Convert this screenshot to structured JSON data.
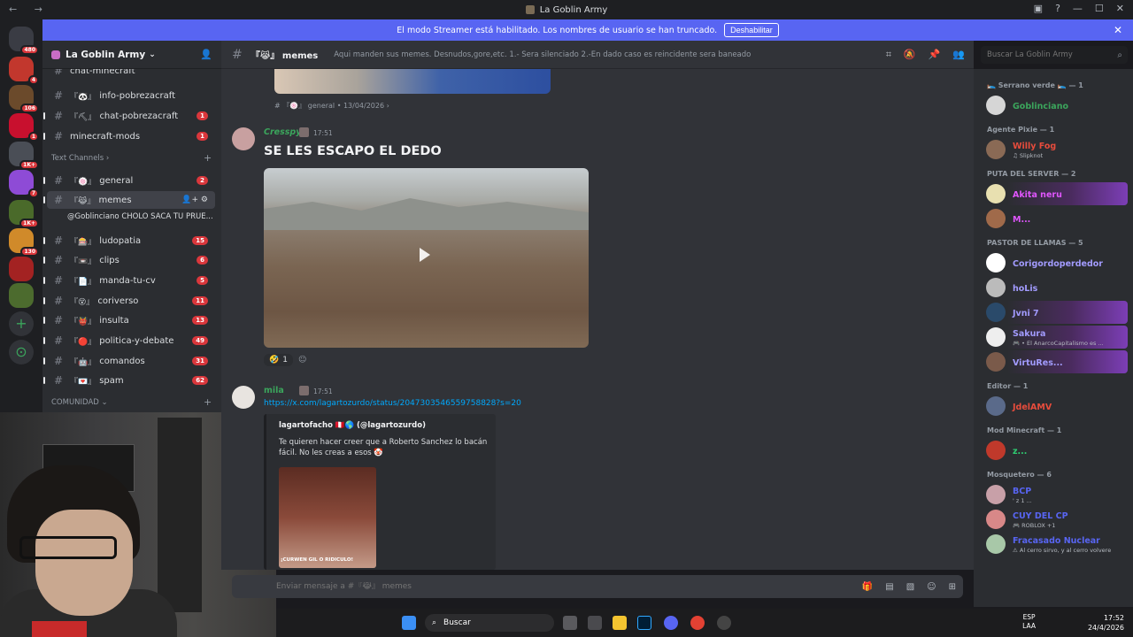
{
  "window": {
    "title": "La Goblin Army"
  },
  "banner": {
    "text": "El modo Streamer está habilitado. Los nombres de usuario se han truncado.",
    "button": "Deshabilitar"
  },
  "guilds": [
    {
      "badge": "480",
      "color": "#3a3c44"
    },
    {
      "badge": "4",
      "color": "#c2372d"
    },
    {
      "badge": "106",
      "color": "#6b4a2b"
    },
    {
      "badge": "1",
      "color": "#c8102e"
    },
    {
      "badge": "1K+",
      "color": "#4a4e56"
    },
    {
      "badge": "7",
      "color": "#8e4bd6"
    },
    {
      "badge": "1K+",
      "color": "#4a6a2a"
    },
    {
      "badge": "130",
      "color": "#d08a2a"
    },
    {
      "badge": "",
      "color": "#a32222"
    },
    {
      "badge": "",
      "color": "#4c6b2e"
    }
  ],
  "server": {
    "name": "La Goblin Army"
  },
  "channels": {
    "top_partial": {
      "name": "chat-minecraft",
      "badge": ""
    },
    "items_top": [
      {
        "emoji": "『🐼』",
        "name": "info-pobrezacraft",
        "badge": ""
      },
      {
        "emoji": "『⛏』",
        "name": "chat-pobrezacraft",
        "badge": "1"
      },
      {
        "emoji": "",
        "name": "minecraft-mods",
        "badge": "1"
      }
    ],
    "category_text": "Text Channels",
    "items": [
      {
        "emoji": "『🍥』",
        "name": "general",
        "badge": "2"
      },
      {
        "emoji": "『😹』",
        "name": "memes",
        "badge": ""
      },
      {
        "emoji": "『🎰』",
        "name": "ludopatia",
        "badge": "15"
      },
      {
        "emoji": "『📼』",
        "name": "clips",
        "badge": "6"
      },
      {
        "emoji": "『📄』",
        "name": "manda-tu-cv",
        "badge": "5"
      },
      {
        "emoji": "『😵』",
        "name": "coriverso",
        "badge": "11"
      },
      {
        "emoji": "『👹』",
        "name": "insulta",
        "badge": "13"
      },
      {
        "emoji": "『🔴』",
        "name": "politica-y-debate",
        "badge": "49"
      },
      {
        "emoji": "『🤖』",
        "name": "comandos",
        "badge": "31"
      },
      {
        "emoji": "『💌』",
        "name": "spam",
        "badge": "62"
      }
    ],
    "thread": "@Goblinciano CHOLO SACA TU PRUE...",
    "category_comunidad": "COMUNIDAD"
  },
  "chat_header": {
    "emoji": "『😹』",
    "name": "memes",
    "topic": "Aqui manden sus memes. Desnudos,gore,etc. 1.- Sera silenciado 2.-En dado caso es reincidente sera baneado"
  },
  "search": {
    "placeholder": "Buscar La Goblin Army"
  },
  "messages": {
    "reply_ref": "『🍥』 general  •  13/04/2026  ›",
    "msg1": {
      "user": "Cresspy",
      "time": "17:51",
      "text": "SE LES ESCAPO EL DEDO",
      "reaction_count": "1"
    },
    "msg2": {
      "user": "mila",
      "time": "17:51",
      "link": "https://x.com/lagartozurdo/status/2047303546559758828?s=20",
      "embed_author": "lagartofacho 🇵🇪🌎 (@lagartozurdo)",
      "embed_text": "Te quieren hacer creer que a Roberto Sanchez lo bacán fácil. No les creas a esos 🤡",
      "thumb_caption": "¡CURWEN GIL O RIDICULO!"
    }
  },
  "input": {
    "placeholder": "Enviar mensaje a #『😹』 memes"
  },
  "members": {
    "groups": [
      {
        "title": "🛌 Serrano verde 🛌 — 1",
        "members": [
          {
            "name": "Goblinciano",
            "sub": "",
            "color": "#3ba55c"
          }
        ]
      },
      {
        "title": "Agente Pixie — 1",
        "members": [
          {
            "name": "Willy Fog",
            "sub": "♫ Slipknot",
            "color": "#e74c3c"
          }
        ]
      },
      {
        "title": "PUTA DEL SERVER — 2",
        "members": [
          {
            "name": "Akita neru",
            "sub": "",
            "color": "#e056fd"
          },
          {
            "name": "M...",
            "sub": "",
            "color": "#e056fd"
          }
        ]
      },
      {
        "title": "PASTOR DE LLAMAS — 5",
        "members": [
          {
            "name": "Corigordoperdedor",
            "sub": "",
            "color": "#a29bfe"
          },
          {
            "name": "hoLis",
            "sub": "",
            "color": "#a29bfe"
          },
          {
            "name": "Jvni 7",
            "sub": "",
            "color": "#a29bfe"
          },
          {
            "name": "Sakura",
            "sub": "🎮 • El AnarcoCapitalismo es ...",
            "color": "#a29bfe"
          },
          {
            "name": "VirtuRes...",
            "sub": "",
            "color": "#a29bfe"
          }
        ]
      },
      {
        "title": "Editor — 1",
        "members": [
          {
            "name": "JdelAMV",
            "sub": "",
            "color": "#e74c3c"
          }
        ]
      },
      {
        "title": "Mod Minecraft — 1",
        "members": [
          {
            "name": "z...",
            "sub": "",
            "color": "#2ecc71"
          }
        ]
      },
      {
        "title": "Mosquetero — 6",
        "members": [
          {
            "name": "BCP",
            "sub": "' z 1 ...",
            "color": "#5865f2"
          },
          {
            "name": "CUY DEL CP",
            "sub": "🎮 ROBLOX +1",
            "color": "#5865f2"
          },
          {
            "name": "Fracasado Nuclear",
            "sub": "⚠ Al cerro sirvo, y al cerro volvere",
            "color": "#5865f2"
          }
        ]
      }
    ]
  },
  "taskbar": {
    "search": "Buscar",
    "lang": "ESP\nLAA",
    "time": "17:52",
    "date": "24/4/2026"
  }
}
